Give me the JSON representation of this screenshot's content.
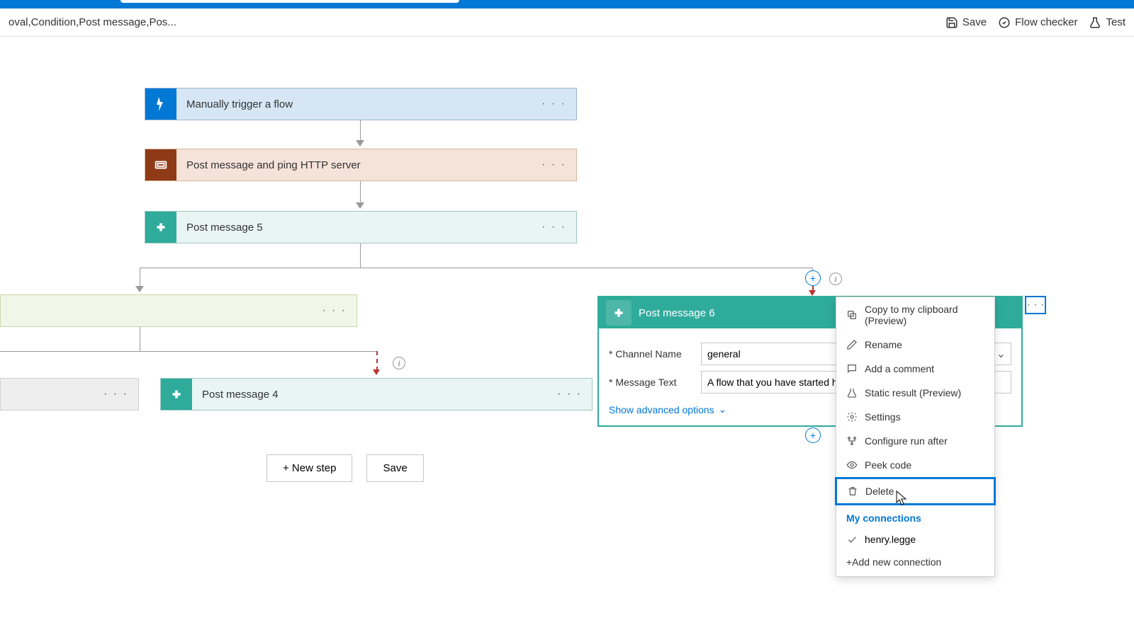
{
  "header": {
    "breadcrumb": "oval,Condition,Post message,Pos...",
    "save": "Save",
    "flow_checker": "Flow checker",
    "test": "Test"
  },
  "cards": {
    "trigger": {
      "title": "Manually trigger a flow"
    },
    "http": {
      "title": "Post message and ping HTTP server"
    },
    "pm5": {
      "title": "Post message 5"
    },
    "pm4": {
      "title": "Post message 4"
    },
    "pm6": {
      "title": "Post message 6",
      "channel_label": "Channel Name",
      "channel_value": "general",
      "message_label": "Message Text",
      "message_value": "A flow that you have started has",
      "show_advanced": "Show advanced options"
    }
  },
  "menu": {
    "copy": "Copy to my clipboard (Preview)",
    "rename": "Rename",
    "add_comment": "Add a comment",
    "static_result": "Static result (Preview)",
    "settings": "Settings",
    "configure": "Configure run after",
    "peek": "Peek code",
    "delete": "Delete",
    "my_connections": "My connections",
    "connection_name": "henry.legge",
    "add_connection": "+Add new connection"
  },
  "footer": {
    "new_step": "+ New step",
    "save": "Save"
  }
}
